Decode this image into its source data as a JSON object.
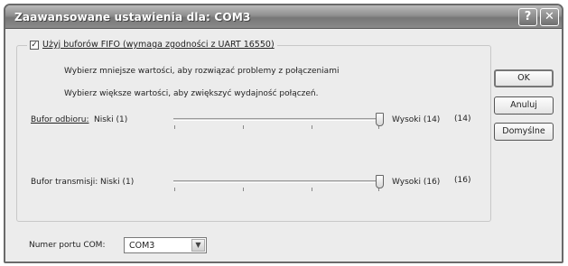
{
  "window": {
    "title": "Zaawansowane ustawienia dla: COM3",
    "help_glyph": "?",
    "close_glyph": "✕"
  },
  "fifo": {
    "checkbox_mark": "✓",
    "checkbox_label": "Użyj buforów FIFO (wymaga zgodności z UART 16550)",
    "checked": true,
    "hint_lower": "Wybierz mniejsze wartości, aby rozwiązać problemy z połączeniami",
    "hint_higher": "Wybierz większe wartości, aby zwiększyć wydajność połączeń."
  },
  "receive": {
    "label": "Bufor odbioru:",
    "min_label": "Niski (1)",
    "max_label": "Wysoki (14)",
    "value_display": "(14)",
    "level": 1.0
  },
  "transmit": {
    "label": "Bufor transmisji:",
    "min_label": "Niski (1)",
    "max_label": "Wysoki (16)",
    "value_display": "(16)",
    "level": 1.0
  },
  "buttons": {
    "ok": "OK",
    "cancel": "Anuluj",
    "defaults": "Domyślne"
  },
  "com_port": {
    "label": "Numer portu COM:",
    "value": "COM3",
    "arrow_glyph": "▼"
  }
}
